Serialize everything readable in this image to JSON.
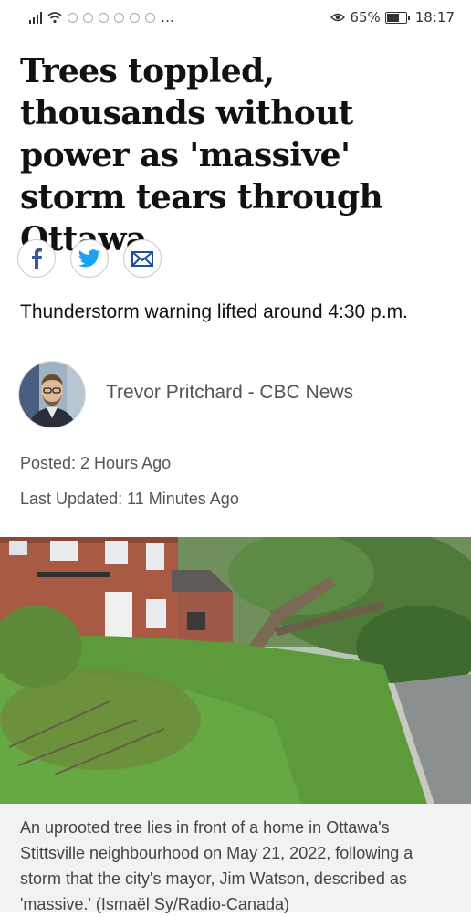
{
  "status_bar": {
    "battery": "65%",
    "time": "18:17",
    "more": "…"
  },
  "article": {
    "headline": "Trees toppled, thousands without power as 'massive' storm tears through Ottawa",
    "deck": "Thunderstorm warning lifted around 4:30 p.m.",
    "byline": "Trevor Pritchard - CBC News",
    "posted": "Posted: 2 Hours Ago",
    "updated": "Last Updated: 11 Minutes Ago",
    "caption": "An uprooted tree lies in front of a home in Ottawa's Stittsville neighbourhood on May 21, 2022, following a storm that the city's mayor, Jim Watson, described as 'massive.' (Ismaël Sy/Radio-Canada)"
  },
  "share": [
    {
      "icon": "facebook-icon",
      "color": "#3b5998"
    },
    {
      "icon": "twitter-icon",
      "color": "#1da1f2"
    },
    {
      "icon": "email-icon",
      "color": "#1a4fa3"
    }
  ]
}
